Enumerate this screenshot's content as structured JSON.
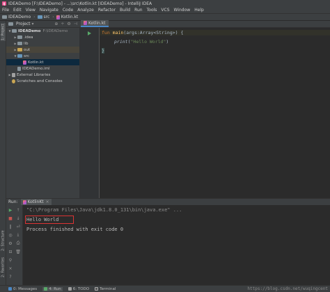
{
  "window": {
    "title": "IDEADemo [F:\\IDEADemo] - ...\\src\\Kotlin.kt [IDEADemo] - IntelliJ IDEA",
    "app_icon": "IJ"
  },
  "menu": [
    "File",
    "Edit",
    "View",
    "Navigate",
    "Code",
    "Analyze",
    "Refactor",
    "Build",
    "Run",
    "Tools",
    "VCS",
    "Window",
    "Help"
  ],
  "breadcrumbs": [
    "IDEADemo",
    "src",
    "Kotlin.kt"
  ],
  "sidebar": {
    "tab1": "1: Project",
    "tab2": "2: Structure",
    "tab3": "2: Favorites"
  },
  "project": {
    "header": "Project",
    "tree": [
      {
        "label": "IDEADemo",
        "extra": "F:\\IDEADemo",
        "icon": "folder-icon"
      },
      {
        "label": ".idea"
      },
      {
        "label": "lib"
      },
      {
        "label": "out"
      },
      {
        "label": "src"
      },
      {
        "label": "Kotlin.kt"
      },
      {
        "label": "IDEADemo.iml"
      },
      {
        "label": "External Libraries"
      },
      {
        "label": "Scratches and Consoles"
      }
    ]
  },
  "editor": {
    "tab": "Kotlin.kt",
    "line1": {
      "kw": "fun ",
      "name": "main",
      "rest": "(args:Array<String>) {"
    },
    "line2": {
      "fn": "print",
      "open": "(",
      "str": "\"Hello World\"",
      "close": ")"
    },
    "line3": "}"
  },
  "run": {
    "label": "Run:",
    "tab": "KotlinKt",
    "console": {
      "line1": "\"C:\\Program Files\\Java\\jdk1.8.0_131\\bin\\java.exe\" ...",
      "line2": "Hello World",
      "line3": "Process finished with exit code 0"
    }
  },
  "status": {
    "messages": "0: Messages",
    "run": "4: Run",
    "todo": "6: TODO",
    "terminal": "Terminal"
  },
  "watermark": "https://blog.csdn.net/wuqingcent"
}
